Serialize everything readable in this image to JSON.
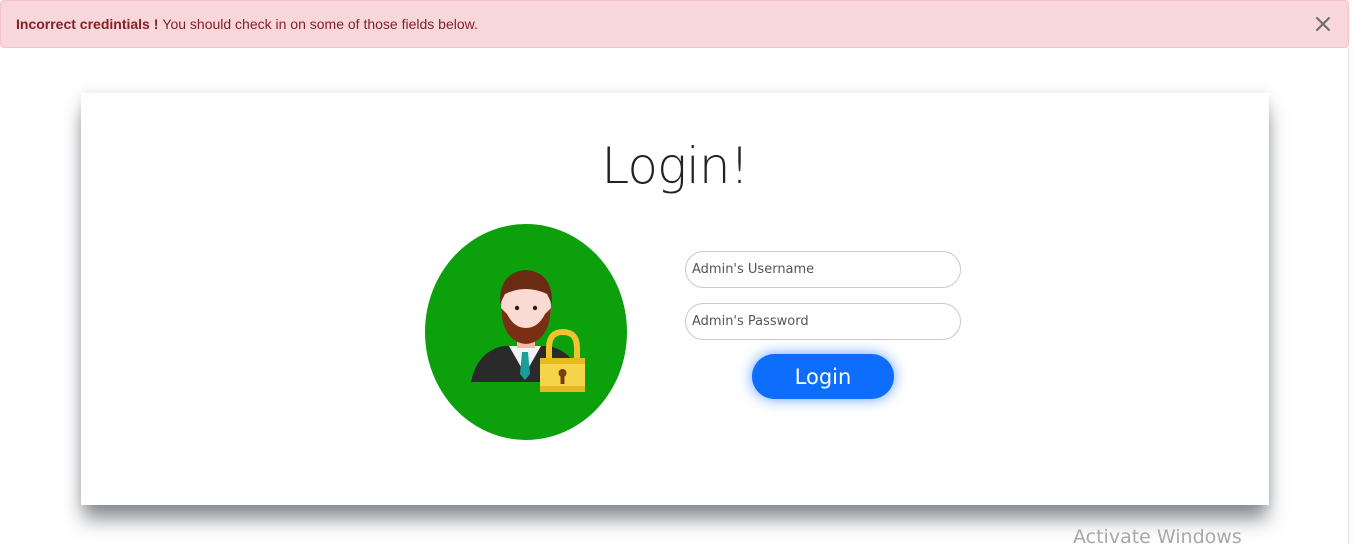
{
  "alert": {
    "title": "Incorrect credintials !",
    "message": "You should check in on some of those fields below.",
    "close_icon": "close-icon",
    "background": "#f8d7da",
    "text_color": "#842029"
  },
  "login": {
    "heading": "Login!",
    "avatar_icon": "admin-lock-avatar-icon",
    "avatar_color": "#0ca00c",
    "username": {
      "value": "",
      "placeholder": "Admin's Username"
    },
    "password": {
      "value": "",
      "placeholder": "Admin's Password"
    },
    "submit_label": "Login",
    "button_color": "#0d6efd"
  },
  "os_watermark": "Activate Windows"
}
